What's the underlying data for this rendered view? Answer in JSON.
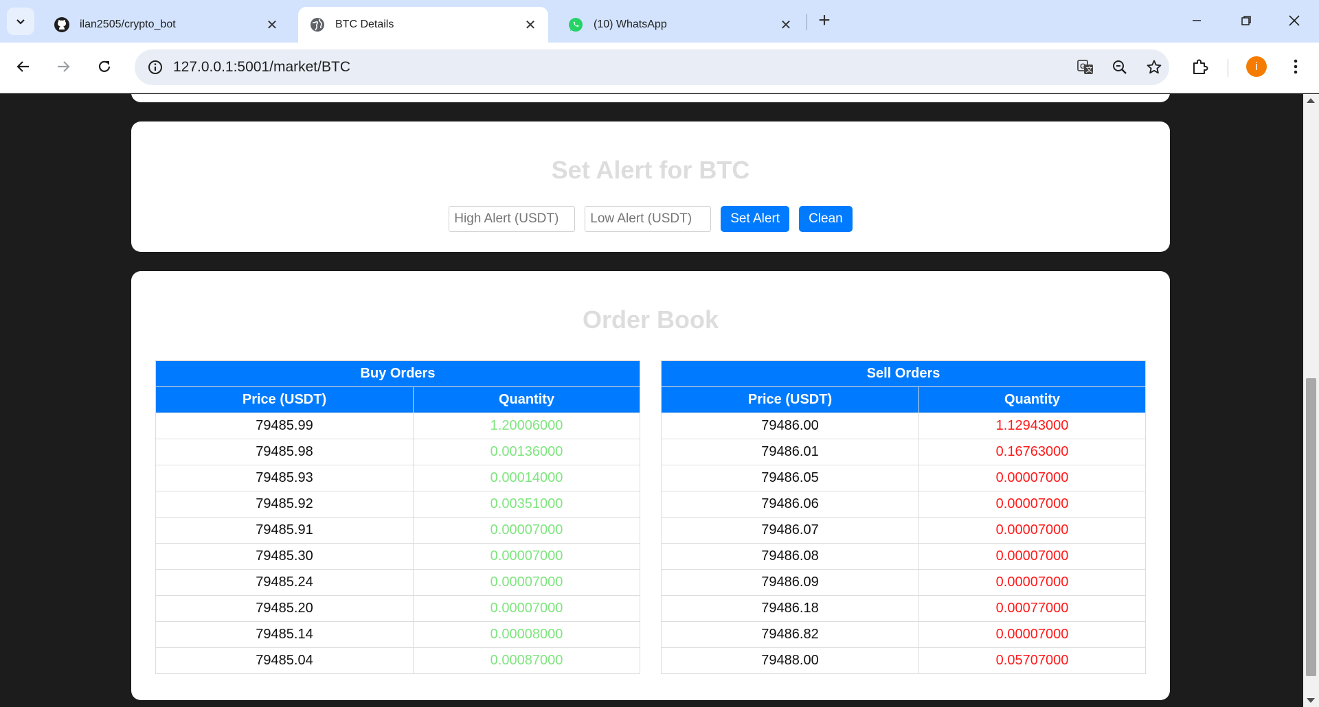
{
  "browser": {
    "tabs": [
      {
        "title": "ilan2505/crypto_bot",
        "icon": "github-icon"
      },
      {
        "title": "BTC Details",
        "icon": "globe-icon"
      },
      {
        "title": "(10) WhatsApp",
        "icon": "whatsapp-icon"
      }
    ],
    "url": "127.0.0.1:5001/market/BTC",
    "avatar_letter": "i",
    "accent": "#d3e3fd"
  },
  "alert": {
    "title": "Set Alert for BTC",
    "high_placeholder": "High Alert (USDT)",
    "low_placeholder": "Low Alert (USDT)",
    "set_label": "Set Alert",
    "clean_label": "Clean"
  },
  "order_book": {
    "title": "Order Book",
    "buy": {
      "heading": "Buy Orders",
      "price_header": "Price (USDT)",
      "qty_header": "Quantity",
      "color": "#7fe57f",
      "rows": [
        {
          "price": "79485.99",
          "qty": "1.20006000"
        },
        {
          "price": "79485.98",
          "qty": "0.00136000"
        },
        {
          "price": "79485.93",
          "qty": "0.00014000"
        },
        {
          "price": "79485.92",
          "qty": "0.00351000"
        },
        {
          "price": "79485.91",
          "qty": "0.00007000"
        },
        {
          "price": "79485.30",
          "qty": "0.00007000"
        },
        {
          "price": "79485.24",
          "qty": "0.00007000"
        },
        {
          "price": "79485.20",
          "qty": "0.00007000"
        },
        {
          "price": "79485.14",
          "qty": "0.00008000"
        },
        {
          "price": "79485.04",
          "qty": "0.00087000"
        }
      ]
    },
    "sell": {
      "heading": "Sell Orders",
      "price_header": "Price (USDT)",
      "qty_header": "Quantity",
      "color": "#ff1a1a",
      "rows": [
        {
          "price": "79486.00",
          "qty": "1.12943000"
        },
        {
          "price": "79486.01",
          "qty": "0.16763000"
        },
        {
          "price": "79486.05",
          "qty": "0.00007000"
        },
        {
          "price": "79486.06",
          "qty": "0.00007000"
        },
        {
          "price": "79486.07",
          "qty": "0.00007000"
        },
        {
          "price": "79486.08",
          "qty": "0.00007000"
        },
        {
          "price": "79486.09",
          "qty": "0.00007000"
        },
        {
          "price": "79486.18",
          "qty": "0.00077000"
        },
        {
          "price": "79486.82",
          "qty": "0.00007000"
        },
        {
          "price": "79488.00",
          "qty": "0.05707000"
        }
      ]
    }
  }
}
